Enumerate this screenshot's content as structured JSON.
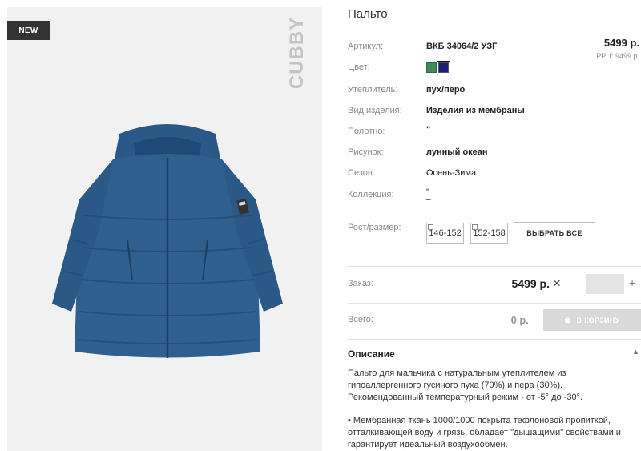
{
  "product": {
    "badge": "NEW",
    "brand": "CUBBY",
    "title": "Пальто"
  },
  "attributes": [
    {
      "label": "Артикул:",
      "value": "ВКБ 34064/2 УЗГ"
    },
    {
      "label": "Цвет:",
      "value": ""
    },
    {
      "label": "Утеплитель:",
      "value": "пух/перо"
    },
    {
      "label": "Вид изделия:",
      "value": "Изделия из мембраны"
    },
    {
      "label": "Полотно:",
      "value": "\""
    },
    {
      "label": "Рисунок:",
      "value": "лунный океан"
    },
    {
      "label": "Сезон:",
      "value": "Осень-Зима"
    },
    {
      "label": "Коллекция:",
      "value": "\""
    },
    {
      "label": "Рост/размер:",
      "value": ""
    }
  ],
  "colors": {
    "swatch_green": "#3f8a58",
    "swatch_navy": "#1b1c7a",
    "jacket": "#2e5f8e"
  },
  "pricing": {
    "price": "5499 р.",
    "rrp": "РРЦ: 9499 р."
  },
  "sizes": [
    "146-152",
    "152-158"
  ],
  "select_all_label": "ВЫБРАТЬ ВСЕ",
  "order": {
    "label": "Заказ:",
    "price": "5499 р.",
    "times_symbol": "×",
    "minus": "–",
    "plus": "+",
    "quantity_value": ""
  },
  "total": {
    "label": "Всего:",
    "price": "0 р.",
    "cart_button": "В КОРЗИНУ"
  },
  "description": {
    "heading": "Описание",
    "toggle": "▲",
    "paragraph1": "Пальто для мальчика с натуральным утеплителем из гипоаллергенного гусиного пуха (70%) и пера (30%). Рекомендованный температурный режим - от -5° до -30°.",
    "paragraph2": "• Мембранная ткань 1000/1000 покрыта тефлоновой пропиткой, отталкивающей воду и грязь, обладает \"дышащими\" свойствами и гарантирует идеальный воздухообмен."
  }
}
